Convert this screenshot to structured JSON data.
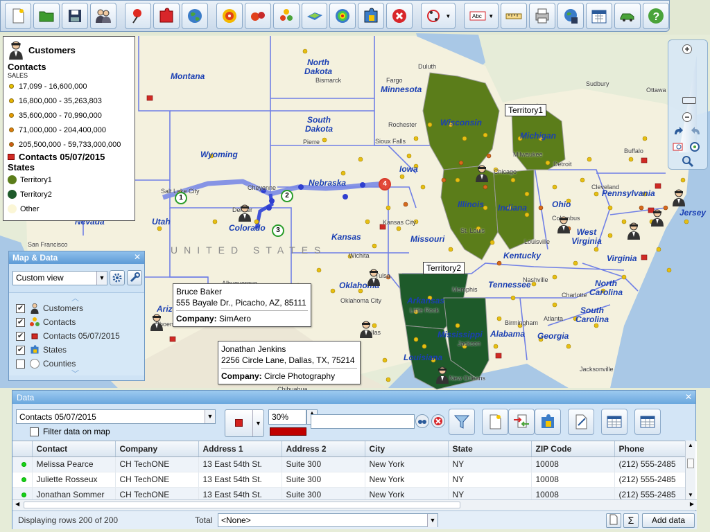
{
  "legend": {
    "title": "Customers",
    "contacts_title": "Contacts",
    "contacts_sub": "SALES",
    "ranges": [
      {
        "label": "17,099 - 16,600,000",
        "color": "#e8c400"
      },
      {
        "label": "16,800,000 - 35,263,803",
        "color": "#e8b600"
      },
      {
        "label": "35,600,000 - 70,990,000",
        "color": "#e89c00"
      },
      {
        "label": "71,000,000 - 204,400,000",
        "color": "#e07a10"
      },
      {
        "label": "205,500,000 - 59,733,000,000",
        "color": "#d05818"
      }
    ],
    "contacts_date": "Contacts 05/07/2015",
    "states_title": "States",
    "states": [
      {
        "label": "Territory1",
        "color": "#5b7d1a"
      },
      {
        "label": "Territory2",
        "color": "#1e5a2a"
      },
      {
        "label": "Other",
        "color": "#fbf6d6"
      }
    ]
  },
  "map": {
    "states": [
      {
        "name": "Montana"
      },
      {
        "name": "North Dakota"
      },
      {
        "name": "Minnesota"
      },
      {
        "name": "South Dakota"
      },
      {
        "name": "Wyoming"
      },
      {
        "name": "Wisconsin"
      },
      {
        "name": "Michigan"
      },
      {
        "name": "Iowa"
      },
      {
        "name": "Nebraska"
      },
      {
        "name": "Nevada"
      },
      {
        "name": "Utah"
      },
      {
        "name": "Colorado"
      },
      {
        "name": "Illinois"
      },
      {
        "name": "Indiana"
      },
      {
        "name": "Ohio"
      },
      {
        "name": "Pennsylvania"
      },
      {
        "name": "Kansas"
      },
      {
        "name": "Missouri"
      },
      {
        "name": "West Virginia"
      },
      {
        "name": "Virginia"
      },
      {
        "name": "Kentucky"
      },
      {
        "name": "Oklahoma"
      },
      {
        "name": "Tennessee"
      },
      {
        "name": "North Carolina"
      },
      {
        "name": "Arizona"
      },
      {
        "name": "Arkansas"
      },
      {
        "name": "South Carolina"
      },
      {
        "name": "Mississippi"
      },
      {
        "name": "Alabama"
      },
      {
        "name": "Georgia"
      },
      {
        "name": "Louisiana"
      },
      {
        "name": "Jersey"
      }
    ],
    "cities": [
      "Bismarck",
      "Fargo",
      "Duluth",
      "Sudbury",
      "Ottawa",
      "Rochester",
      "Pierre",
      "Sioux Falls",
      "Milwaukee",
      "Chicago",
      "Detroit",
      "Cleveland",
      "Buffalo",
      "Salt Lake City",
      "Cheyenne",
      "Denver",
      "Kansas City",
      "St. Louis",
      "Wichita",
      "Louisville",
      "Columbus",
      "Nashville",
      "Memphis",
      "Tulsa",
      "Oklahoma City",
      "Little Rock",
      "Atlanta",
      "Charlotte",
      "Jackson",
      "Birmingham",
      "Dallas",
      "Albuquerque",
      "San Francisco",
      "Jacksonville",
      "New Orleans",
      "Phoenix",
      "Chihuahua"
    ],
    "country_label": "UNITED STATES",
    "territory1_label": "Territory1",
    "territory2_label": "Territory2",
    "route_stops": [
      "1",
      "2",
      "3",
      "4"
    ],
    "callouts": [
      {
        "name": "Bruce Baker",
        "address": "555 Bayale Dr., Picacho, AZ, 85111",
        "company_label": "Company:",
        "company": "SimAero"
      },
      {
        "name": "Jonathan Jenkins",
        "address": "2256 Circle Lane, Dallas, TX, 75214",
        "company_label": "Company:",
        "company": "Circle Photography"
      }
    ]
  },
  "map_data_panel": {
    "title": "Map & Data",
    "view": "Custom view",
    "layers": [
      {
        "label": "Customers",
        "checked": true
      },
      {
        "label": "Contacts",
        "checked": true
      },
      {
        "label": "Contacts 05/07/2015",
        "checked": true
      },
      {
        "label": "States",
        "checked": true
      },
      {
        "label": "Counties",
        "checked": false
      }
    ]
  },
  "data_panel": {
    "title": "Data",
    "dataset": "Contacts 05/07/2015",
    "filter_label": "Filter data on map",
    "opacity": "30%",
    "search_value": "",
    "columns": [
      "",
      "Contact",
      "Company",
      "Address 1",
      "Address 2",
      "City",
      "State",
      "ZIP Code",
      "Phone"
    ],
    "rows": [
      [
        "",
        "Melissa Pearce",
        "CH TechONE",
        "13 East 54th St.",
        "Suite 300",
        "New York",
        "NY",
        "10008",
        "(212) 555-2485"
      ],
      [
        "",
        "Juliette Rosseux",
        "CH TechONE",
        "13 East 54th St.",
        "Suite 300",
        "New York",
        "NY",
        "10008",
        "(212) 555-2485"
      ],
      [
        "",
        "Jonathan Sommer",
        "CH TechONE",
        "13 East 54th St.",
        "Suite 300",
        "New York",
        "NY",
        "10008",
        "(212) 555-2485"
      ]
    ],
    "status": "Displaying rows 200 of 200",
    "total_label": "Total",
    "total_value": "<None>",
    "add_button": "Add data"
  },
  "colors": {
    "territory1": "#5b7d1a",
    "territory2": "#1e5a2a",
    "route": "#6b7fe0",
    "accent": "#6aa7de"
  }
}
